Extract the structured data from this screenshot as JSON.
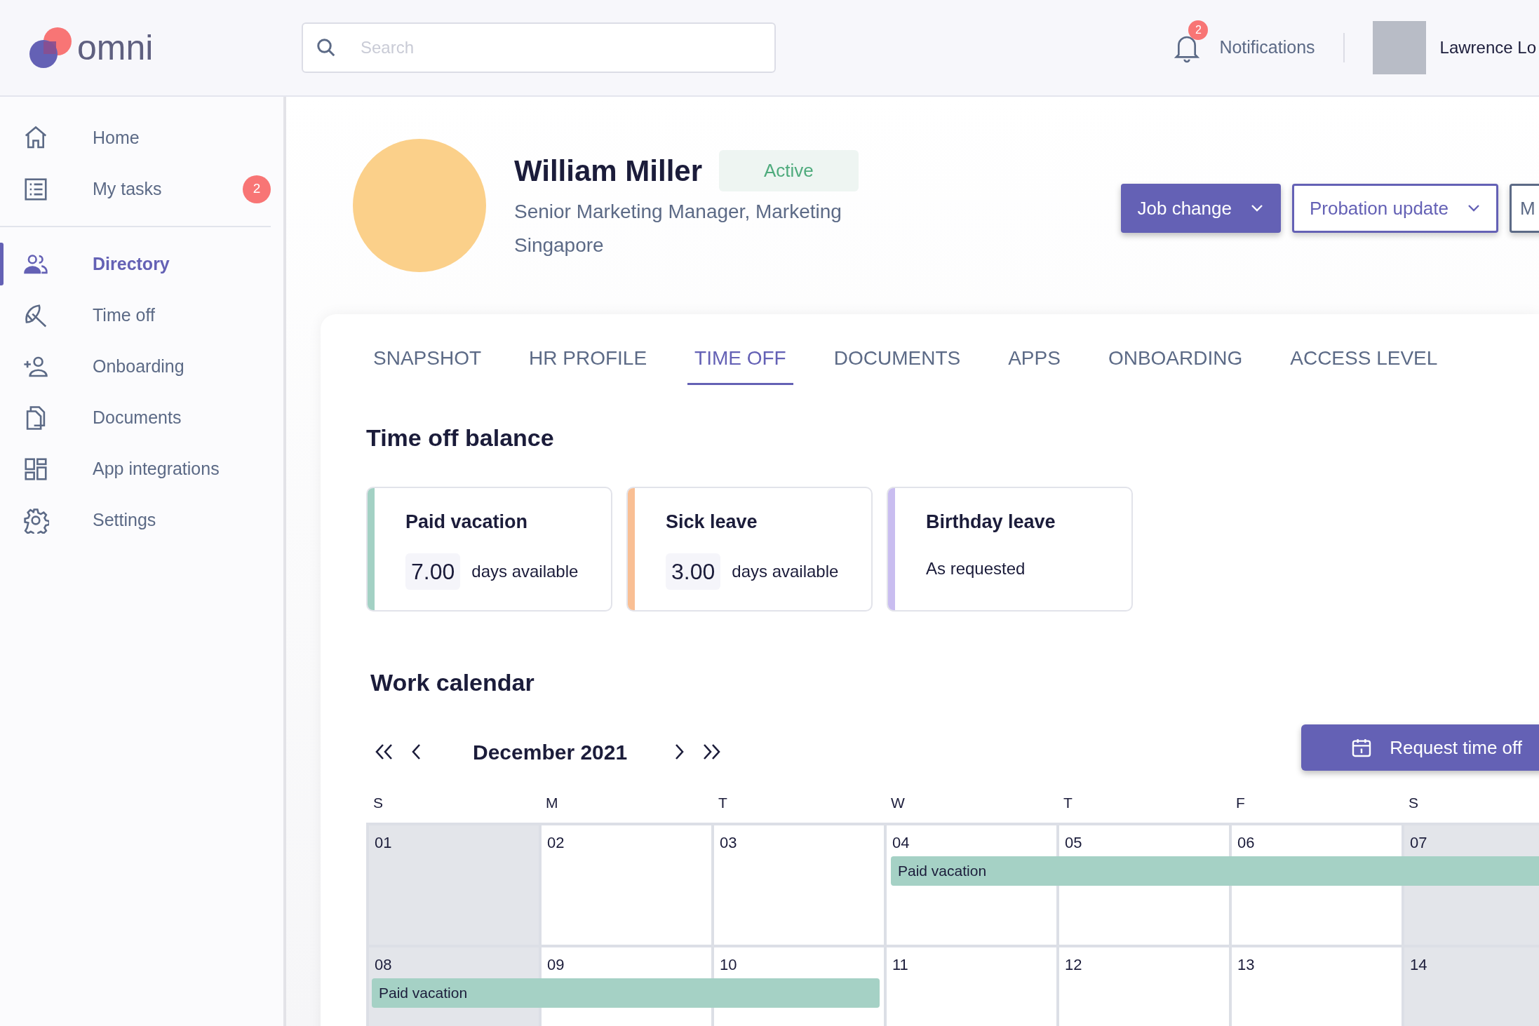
{
  "header": {
    "logo": "omni",
    "search": {
      "placeholder": "Search"
    },
    "notifications": {
      "label": "Notifications",
      "count": "2"
    },
    "user": {
      "name": "Lawrence Lo"
    }
  },
  "sidebar": {
    "groups": [
      [
        {
          "label": "Home",
          "selected": false
        },
        {
          "label": "My tasks",
          "selected": false,
          "badge": "2"
        }
      ],
      [
        {
          "label": "Directory",
          "selected": true
        },
        {
          "label": "Time off",
          "selected": false
        },
        {
          "label": "Onboarding",
          "selected": false
        },
        {
          "label": "Documents",
          "selected": false
        },
        {
          "label": "App integrations",
          "selected": false
        },
        {
          "label": "Settings",
          "selected": false
        }
      ]
    ]
  },
  "profile": {
    "name": "William Miller",
    "status": "Active",
    "title": "Senior Marketing Manager, Marketing",
    "location": "Singapore",
    "actions": [
      {
        "label": "Job change",
        "kind": "primary"
      },
      {
        "label": "Probation update",
        "kind": "outline"
      },
      {
        "label": "M",
        "kind": "more"
      }
    ]
  },
  "tabs": [
    {
      "label": "SNAPSHOT",
      "selected": false
    },
    {
      "label": "HR PROFILE",
      "selected": false
    },
    {
      "label": "TIME OFF",
      "selected": true
    },
    {
      "label": "DOCUMENTS",
      "selected": false
    },
    {
      "label": "APPS",
      "selected": false
    },
    {
      "label": "ONBOARDING",
      "selected": false
    },
    {
      "label": "ACCESS LEVEL",
      "selected": false
    }
  ],
  "balance": {
    "title": "Time off balance",
    "cards": [
      {
        "kind": "days",
        "title": "Paid vacation",
        "amount": "7.00",
        "unit": "days available",
        "color": "#a3d1c4"
      },
      {
        "kind": "days",
        "title": "Sick leave",
        "amount": "3.00",
        "unit": "days available",
        "color": "#f9bf94"
      },
      {
        "kind": "note",
        "title": "Birthday leave",
        "note": "As requested",
        "color": "#c9bdf0"
      }
    ]
  },
  "calendar": {
    "title": "Work calendar",
    "month": "December 2021",
    "request_button": "Request time off",
    "weekdays": [
      "S",
      "M",
      "T",
      "W",
      "T",
      "F",
      "S"
    ],
    "weeks": [
      {
        "days": [
          {
            "date": "01",
            "weekend": true,
            "booked": false
          },
          {
            "date": "02",
            "weekend": false,
            "booked": false
          },
          {
            "date": "03",
            "weekend": false,
            "booked": false
          },
          {
            "date": "04",
            "weekend": false,
            "booked": true,
            "event": "Paid vacation"
          },
          {
            "date": "05",
            "weekend": false,
            "booked": true
          },
          {
            "date": "06",
            "weekend": false,
            "booked": true
          },
          {
            "date": "07",
            "weekend": true,
            "booked": true
          }
        ]
      },
      {
        "days": [
          {
            "date": "08",
            "weekend": true,
            "booked": true,
            "event": "Paid vacation"
          },
          {
            "date": "09",
            "weekend": false,
            "booked": true
          },
          {
            "date": "10",
            "weekend": false,
            "booked": true
          },
          {
            "date": "11",
            "weekend": false,
            "booked": false
          },
          {
            "date": "12",
            "weekend": false,
            "booked": false
          },
          {
            "date": "13",
            "weekend": false,
            "booked": false
          },
          {
            "date": "14",
            "weekend": true,
            "booked": false
          }
        ]
      }
    ]
  }
}
